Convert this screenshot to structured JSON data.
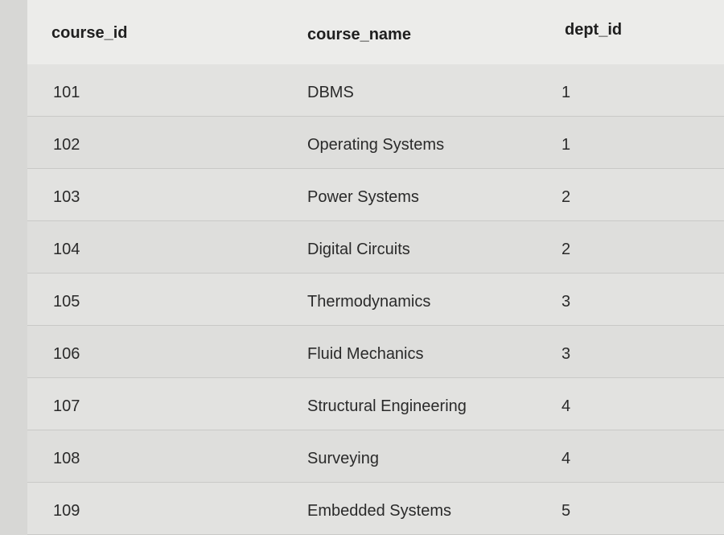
{
  "table": {
    "columns": [
      "course_id",
      "course_name",
      "dept_id"
    ],
    "rows": [
      {
        "course_id": "101",
        "course_name": "DBMS",
        "dept_id": "1"
      },
      {
        "course_id": "102",
        "course_name": "Operating Systems",
        "dept_id": "1"
      },
      {
        "course_id": "103",
        "course_name": "Power Systems",
        "dept_id": "2"
      },
      {
        "course_id": "104",
        "course_name": "Digital Circuits",
        "dept_id": "2"
      },
      {
        "course_id": "105",
        "course_name": "Thermodynamics",
        "dept_id": "3"
      },
      {
        "course_id": "106",
        "course_name": "Fluid Mechanics",
        "dept_id": "3"
      },
      {
        "course_id": "107",
        "course_name": "Structural Engineering",
        "dept_id": "4"
      },
      {
        "course_id": "108",
        "course_name": "Surveying",
        "dept_id": "4"
      },
      {
        "course_id": "109",
        "course_name": "Embedded Systems",
        "dept_id": "5"
      }
    ]
  }
}
